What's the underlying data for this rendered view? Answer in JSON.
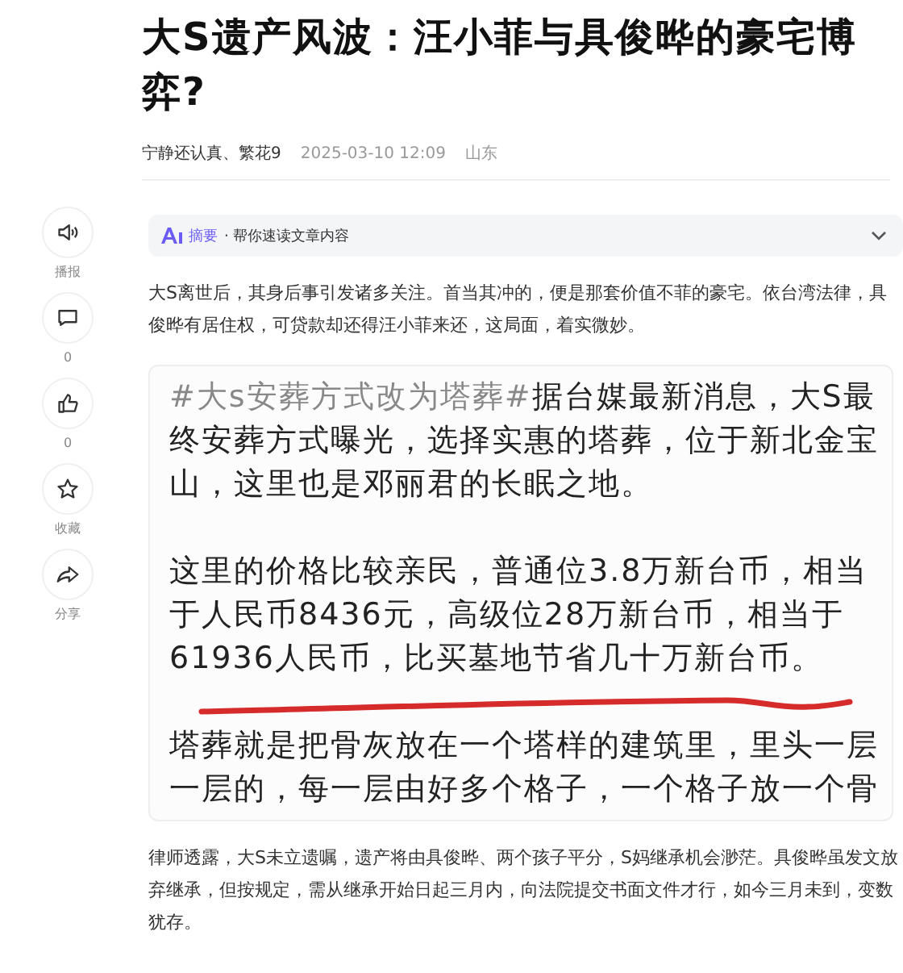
{
  "title": "大S遗产风波：汪小菲与具俊晔的豪宅博弈?",
  "meta": {
    "author": "宁静还认真、繁花9",
    "time": "2025-03-10 12:09",
    "location": "山东"
  },
  "actions": [
    {
      "kind": "speaker",
      "label": "播报"
    },
    {
      "kind": "comment",
      "label": "0"
    },
    {
      "kind": "like",
      "label": "0"
    },
    {
      "kind": "star",
      "label": "收藏"
    },
    {
      "kind": "share",
      "label": "分享"
    }
  ],
  "ai_summary": {
    "badge": "摘要",
    "text": "· 帮你速读文章内容",
    "expanded": false
  },
  "intro": "大S离世后，其身后事引发诸多关注。首当其冲的，便是那套价值不菲的豪宅。依台湾法律，具俊晔有居住权，可贷款却还得汪小菲来还，这局面，着实微妙。",
  "image_post": {
    "hashtag": "#大s安葬方式改为塔葬#",
    "paragraphs": [
      [
        "据台媒最新消息，大S最",
        "终安葬方式曝光，选择实惠的塔葬，位于新北金宝",
        "山，这里也是邓丽君的长眠之地。"
      ],
      [
        "这里的价格比较亲民，普通位3.8万新台币，相当",
        "于人民币8436元，高级位28万新台币，相当于",
        "61936人民币，比买墓地节省几十万新台币。"
      ],
      [
        "塔葬就是把骨灰放在一个塔样的建筑里，里头一层",
        "一层的，每一层由好多个格子，一个格子放一个骨"
      ]
    ]
  },
  "outro": "律师透露，大S未立遗嘱，遗产将由具俊晔、两个孩子平分，S妈继承机会渺茫。具俊晔虽发文放弃继承，但按规定，需从继承开始日起三月内，向法院提交书面文件才行，如今三月未到，变数犹存。"
}
